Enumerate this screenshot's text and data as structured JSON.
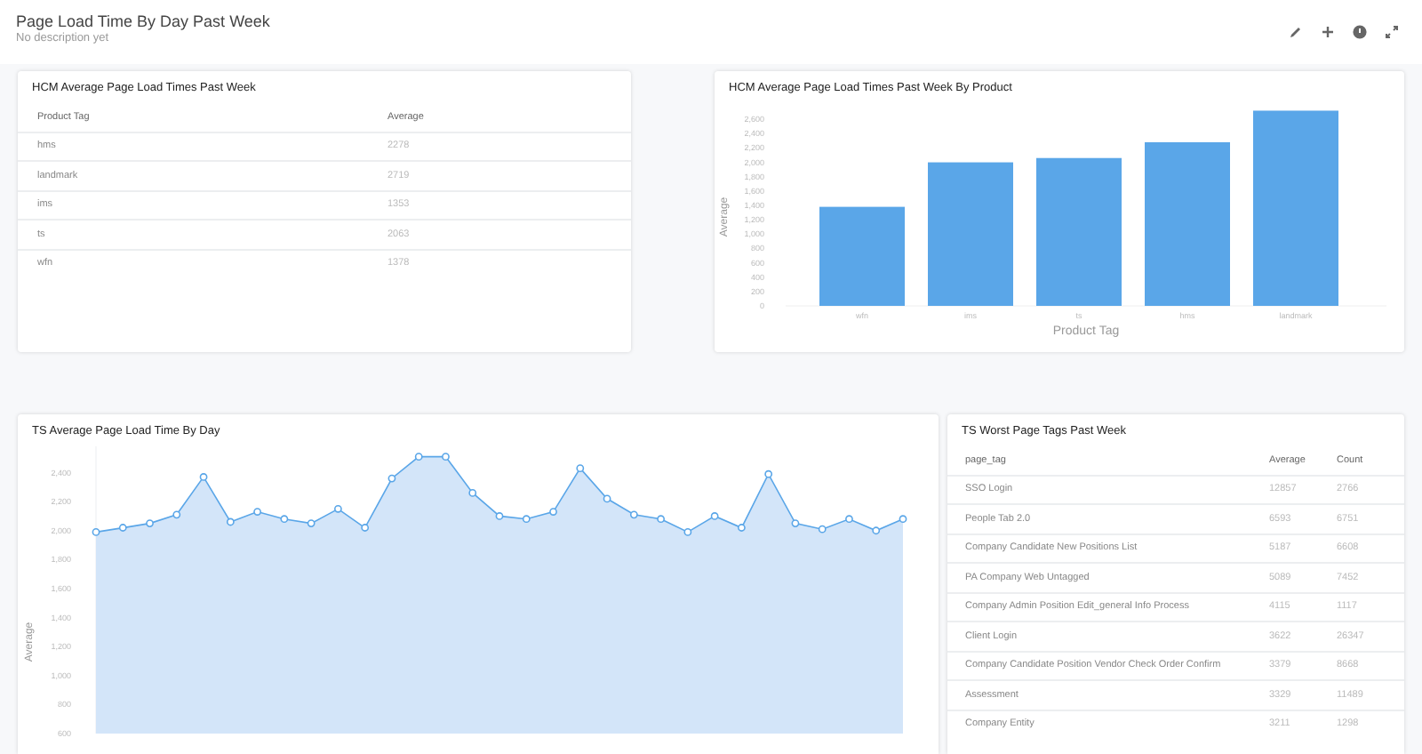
{
  "header": {
    "title": "Page Load Time By Day Past Week",
    "description": "No description yet"
  },
  "cards": [
    {
      "kind": "table",
      "title": "HCM Average Page Load Times Past Week",
      "columns": [
        "Product Tag",
        "Average"
      ],
      "rows": [
        [
          "hms",
          "2278"
        ],
        [
          "landmark",
          "2719"
        ],
        [
          "ims",
          "1353"
        ],
        [
          "ts",
          "2063"
        ],
        [
          "wfn",
          "1378"
        ]
      ]
    },
    {
      "kind": "bar",
      "title": "HCM Average Page Load Times Past Week By Product",
      "chart_data": {
        "type": "bar",
        "xlabel": "Product Tag",
        "ylabel": "Average",
        "categories": [
          "wfn",
          "ims",
          "ts",
          "hms",
          "landmark"
        ],
        "series": [
          {
            "color": "#5aa6e8",
            "values": [
              1380,
              2000,
              2060,
              2280,
              2720
            ]
          }
        ],
        "ylim": [
          0,
          2800
        ],
        "yticks": [
          {
            "value": 0,
            "label": "0"
          },
          {
            "value": 200,
            "label": "200"
          },
          {
            "value": 400,
            "label": "400"
          },
          {
            "value": 600,
            "label": "600"
          },
          {
            "value": 800,
            "label": "800"
          },
          {
            "value": 1000,
            "label": "1,000"
          },
          {
            "value": 1200,
            "label": "1,200"
          },
          {
            "value": 1400,
            "label": "1,400"
          },
          {
            "value": 1600,
            "label": "1,600"
          },
          {
            "value": 1800,
            "label": "1,800"
          },
          {
            "value": 2000,
            "label": "2,000"
          },
          {
            "value": 2200,
            "label": "2,200"
          },
          {
            "value": 2400,
            "label": "2,400"
          },
          {
            "value": 2600,
            "label": "2,600"
          }
        ]
      }
    },
    {
      "kind": "line",
      "title": "TS Average Page Load Time By Day",
      "chart_data": {
        "type": "area",
        "ylabel": "Average",
        "ylim": [
          600,
          2600
        ],
        "categories": [
          null,
          null,
          null,
          null,
          null,
          null,
          null,
          null,
          null,
          null,
          null,
          null,
          null,
          null,
          null,
          null,
          null,
          null,
          null,
          null,
          null,
          null,
          null,
          null,
          null,
          null,
          null,
          null,
          null,
          null,
          null
        ],
        "series": [
          {
            "color": "#5aa6e8",
            "values": [
              1990,
              2020,
              2050,
              2110,
              2370,
              2060,
              2130,
              2080,
              2050,
              2150,
              2020,
              2360,
              2510,
              2510,
              2260,
              2100,
              2080,
              2130,
              2430,
              2220,
              2110,
              2080,
              1990,
              2100,
              2020,
              2390,
              2050,
              2010,
              2080,
              2000,
              2080
            ]
          }
        ],
        "yticks": [
          {
            "value": 600,
            "label": "600"
          },
          {
            "value": 800,
            "label": "800"
          },
          {
            "value": 1000,
            "label": "1,000"
          },
          {
            "value": 1200,
            "label": "1,200"
          },
          {
            "value": 1400,
            "label": "1,400"
          },
          {
            "value": 1600,
            "label": "1,600"
          },
          {
            "value": 1800,
            "label": "1,800"
          },
          {
            "value": 2000,
            "label": "2,000"
          },
          {
            "value": 2200,
            "label": "2,200"
          },
          {
            "value": 2400,
            "label": "2,400"
          }
        ]
      }
    },
    {
      "kind": "table",
      "title": "TS Worst Page Tags Past Week",
      "columns": [
        "page_tag",
        "Average",
        "Count"
      ],
      "rows": [
        [
          "SSO Login",
          "12857",
          "2766"
        ],
        [
          "People Tab 2.0",
          "6593",
          "6751"
        ],
        [
          "Company Candidate New Positions List",
          "5187",
          "6608"
        ],
        [
          "PA Company Web Untagged",
          "5089",
          "7452"
        ],
        [
          "Company Admin Position Edit_general Info Process",
          "4115",
          "1117"
        ],
        [
          "Client Login",
          "3622",
          "26347"
        ],
        [
          "Company Candidate Position Vendor Check Order Confirm",
          "3379",
          "8668"
        ],
        [
          "Assessment",
          "3329",
          "11489"
        ],
        [
          "Company Entity",
          "3211",
          "1298"
        ]
      ]
    }
  ]
}
